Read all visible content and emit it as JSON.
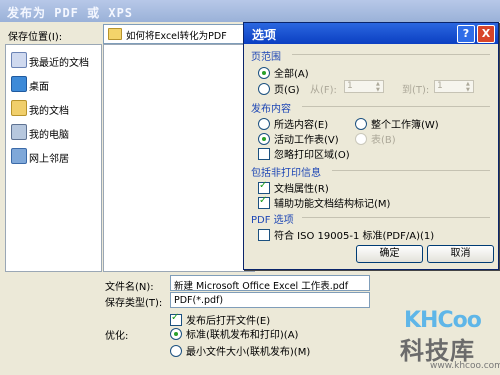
{
  "window": {
    "title": "发布为 PDF 或 XPS"
  },
  "save_location": {
    "label": "保存位置(I):",
    "value": "如何将Excel转化为PDF"
  },
  "places": [
    {
      "label": "我最近的文档",
      "icon": "recent-documents-icon"
    },
    {
      "label": "桌面",
      "icon": "desktop-icon"
    },
    {
      "label": "我的文档",
      "icon": "my-documents-icon"
    },
    {
      "label": "我的电脑",
      "icon": "my-computer-icon"
    },
    {
      "label": "网上邻居",
      "icon": "network-places-icon"
    }
  ],
  "file_name": {
    "label": "文件名(N):",
    "value": "新建 Microsoft Office Excel 工作表.pdf"
  },
  "file_type": {
    "label": "保存类型(T):",
    "value": "PDF(*.pdf)"
  },
  "open_after_publish": {
    "label": "发布后打开文件(E)",
    "checked": true
  },
  "optimize": {
    "label": "优化:",
    "options": [
      {
        "label": "标准(联机发布和打印)(A)",
        "selected": true
      },
      {
        "label": "最小文件大小(联机发布)(M)",
        "selected": false
      }
    ]
  },
  "options_dialog": {
    "title": "选项",
    "help_button": "?",
    "close_button": "X",
    "page_range": {
      "heading": "页范围",
      "all_label": "全部(A)",
      "pages_label": "页(G)",
      "from_label": "从(F):",
      "from_value": "1",
      "to_label": "到(T):",
      "to_value": "1",
      "selected": "all"
    },
    "publish_content": {
      "heading": "发布内容",
      "selection_label": "所选内容(E)",
      "workbook_label": "整个工作簿(W)",
      "active_sheet_label": "活动工作表(V)",
      "table_label": "表(B)",
      "ignore_print_area_label": "忽略打印区域(O)",
      "selected": "active_sheet"
    },
    "non_printing": {
      "heading": "包括非打印信息",
      "doc_properties_label": "文档属性(R)",
      "doc_properties_checked": true,
      "accessibility_tags_label": "辅助功能文档结构标记(M)",
      "accessibility_tags_checked": true
    },
    "pdf_options": {
      "heading": "PDF 选项",
      "iso_label": "符合 ISO 19005-1 标准(PDF/A)(1)",
      "iso_checked": false
    },
    "ok_label": "确定",
    "cancel_label": "取消"
  },
  "watermark": {
    "brand": "KHCoo",
    "name": "科技库",
    "url": "www.khcoo.com"
  },
  "colors": {
    "title_bar": "#0b3fc2",
    "section_heading": "#1e47b5",
    "dialog_face": "#ece9d8"
  }
}
